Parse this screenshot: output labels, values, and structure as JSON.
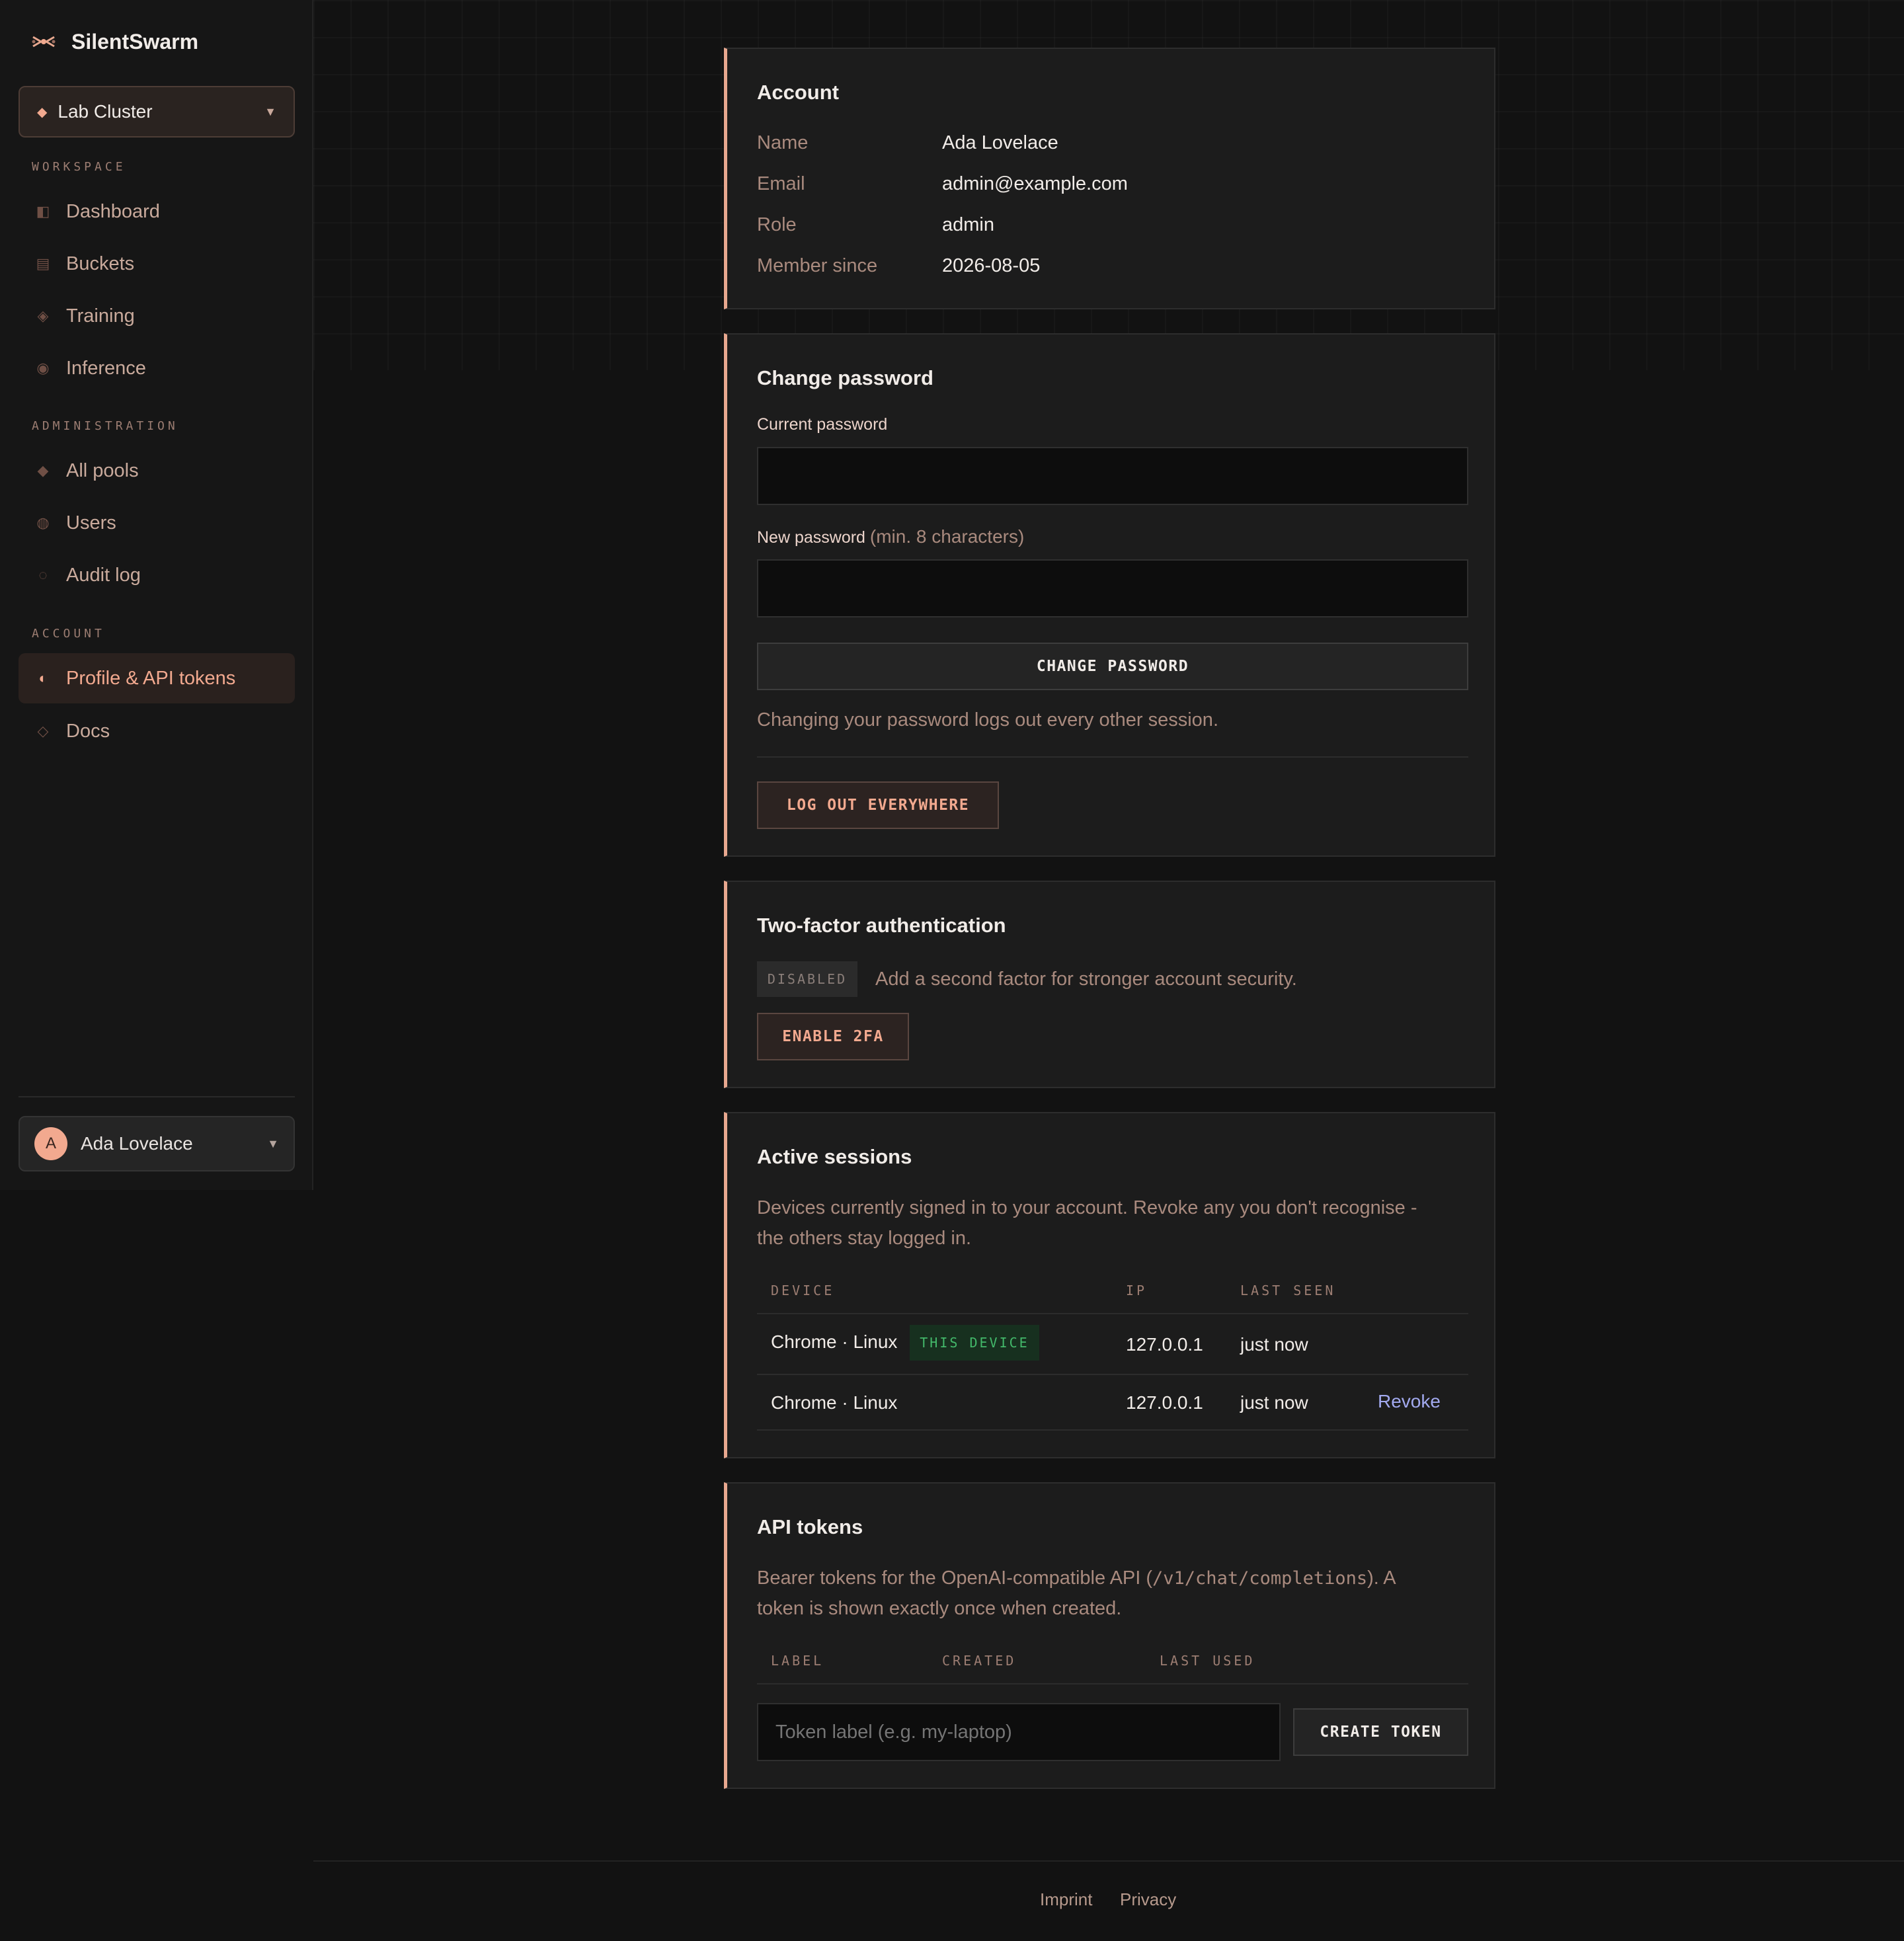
{
  "brand": {
    "name": "SilentSwarm",
    "icon": "swarm-logo-icon"
  },
  "cluster_select": {
    "value": "Lab Cluster"
  },
  "nav": {
    "workspace_label": "WORKSPACE",
    "workspace": [
      {
        "label": "Dashboard",
        "icon": "dashboard-icon"
      },
      {
        "label": "Buckets",
        "icon": "buckets-icon"
      },
      {
        "label": "Training",
        "icon": "training-icon"
      },
      {
        "label": "Inference",
        "icon": "inference-icon"
      }
    ],
    "admin_label": "ADMINISTRATION",
    "admin": [
      {
        "label": "All pools",
        "icon": "pools-icon"
      },
      {
        "label": "Users",
        "icon": "users-icon"
      },
      {
        "label": "Audit log",
        "icon": "audit-icon"
      }
    ],
    "account_label": "ACCOUNT",
    "account": [
      {
        "label": "Profile & API tokens",
        "icon": "profile-icon",
        "active": true
      },
      {
        "label": "Docs",
        "icon": "docs-icon"
      }
    ]
  },
  "user_menu": {
    "initial": "A",
    "name": "Ada Lovelace"
  },
  "account": {
    "title": "Account",
    "rows": [
      {
        "label": "Name",
        "value": "Ada Lovelace"
      },
      {
        "label": "Email",
        "value": "admin@example.com"
      },
      {
        "label": "Role",
        "value": "admin"
      },
      {
        "label": "Member since",
        "value": "2026-08-05"
      }
    ]
  },
  "password": {
    "title": "Change password",
    "current_label": "Current password",
    "new_label": "New password",
    "new_hint": "(min. 8 characters)",
    "submit": "CHANGE PASSWORD",
    "note": "Changing your password logs out every other session.",
    "logout_all": "LOG OUT EVERYWHERE"
  },
  "twofa": {
    "title": "Two-factor authentication",
    "status": "DISABLED",
    "description": "Add a second factor for stronger account security.",
    "enable": "ENABLE 2FA"
  },
  "sessions": {
    "title": "Active sessions",
    "description_1": "Devices currently signed in to your account. Revoke any you don't recognise -",
    "description_2": "the others stay logged in.",
    "columns": [
      "DEVICE",
      "IP",
      "LAST SEEN"
    ],
    "rows": [
      {
        "device": "Chrome · Linux",
        "badge": "THIS DEVICE",
        "ip": "127.0.0.1",
        "last_seen": "just now"
      },
      {
        "device": "Chrome · Linux",
        "ip": "127.0.0.1",
        "last_seen": "just now",
        "action": "Revoke"
      }
    ]
  },
  "tokens": {
    "title": "API tokens",
    "description_pre": "Bearer tokens for the OpenAI-compatible API (",
    "description_code": "/v1/chat/completions",
    "description_post": "). A",
    "description_2": "token is shown exactly once when created.",
    "columns": [
      "LABEL",
      "CREATED",
      "LAST USED"
    ],
    "label_placeholder": "Token label (e.g. my-laptop)",
    "create": "CREATE TOKEN"
  },
  "footer": {
    "imprint": "Imprint",
    "privacy": "Privacy"
  },
  "colors": {
    "accent": "#e8a88f",
    "link": "#a3aaf0",
    "success": "#43b86a",
    "background": "#121212"
  }
}
